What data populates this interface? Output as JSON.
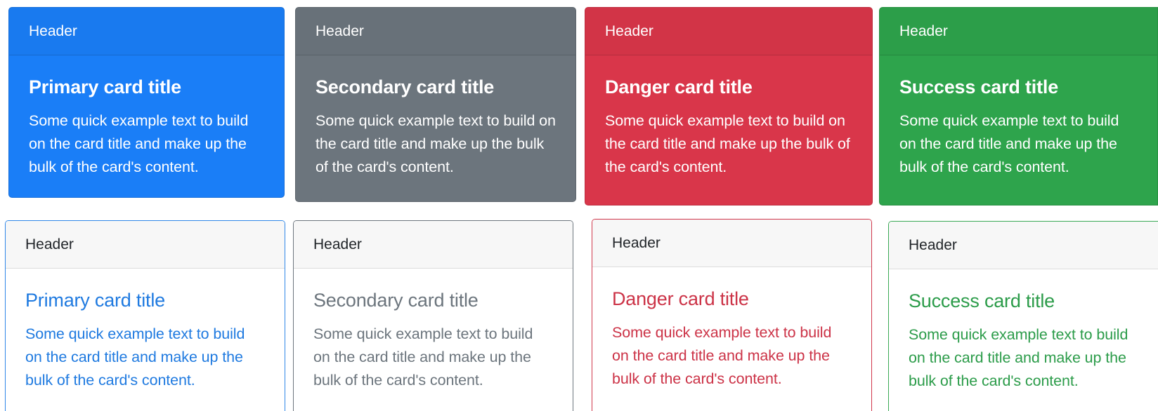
{
  "cards": [
    {
      "variant": "primary",
      "style": "filled",
      "header": "Header",
      "title": "Primary card title",
      "text": "Some quick example text to build on the card title and make up the bulk of the card's content.",
      "color": "#1a7ef7"
    },
    {
      "variant": "secondary",
      "style": "filled",
      "header": "Header",
      "title": "Secondary card title",
      "text": "Some quick example text to build on the card title and make up the bulk of the card's content.",
      "color": "#6c757d"
    },
    {
      "variant": "danger",
      "style": "filled",
      "header": "Header",
      "title": "Danger card title",
      "text": "Some quick example text to build on the card title and make up the bulk of the card's content.",
      "color": "#d9364a"
    },
    {
      "variant": "success",
      "style": "filled",
      "header": "Header",
      "title": "Success card title",
      "text": "Some quick example text to build on the card title and make up the bulk of the card's content.",
      "color": "#2ea44c"
    },
    {
      "variant": "primary",
      "style": "outline",
      "header": "Header",
      "title": "Primary card title",
      "text": "Some quick example text to build on the card title and make up the bulk of the card's content.",
      "color": "#1f7ae0"
    },
    {
      "variant": "secondary",
      "style": "outline",
      "header": "Header",
      "title": "Secondary card title",
      "text": "Some quick example text to build on the card title and make up the bulk of the card's content.",
      "color": "#6c757d"
    },
    {
      "variant": "danger",
      "style": "outline",
      "header": "Header",
      "title": "Danger card title",
      "text": "Some quick example text to build on the card title and make up the bulk of the card's content.",
      "color": "#cc3347"
    },
    {
      "variant": "success",
      "style": "outline",
      "header": "Header",
      "title": "Success card title",
      "text": "Some quick example text to build on the card title and make up the bulk of the card's content.",
      "color": "#2c9c4a"
    }
  ]
}
